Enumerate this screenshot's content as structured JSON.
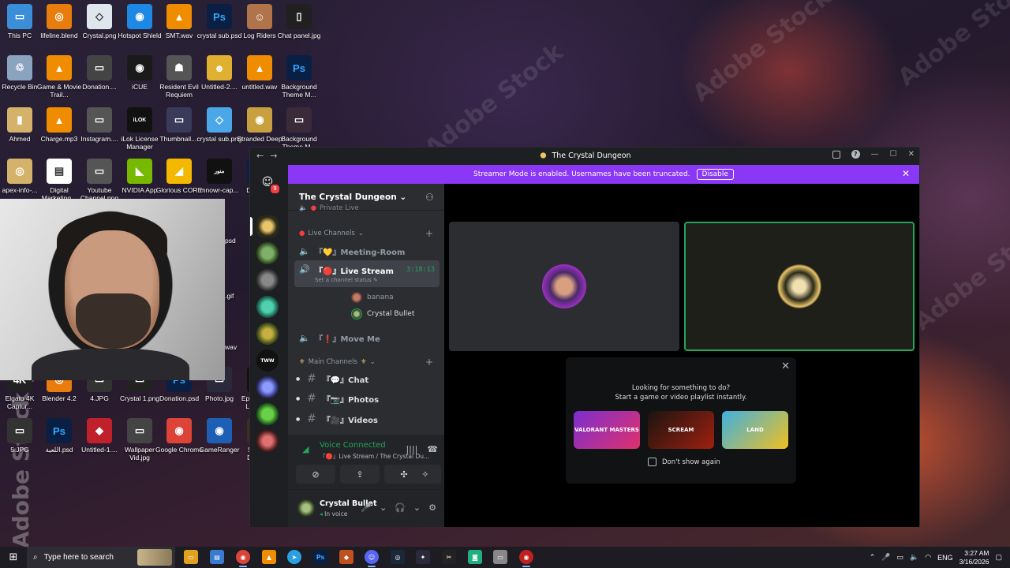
{
  "desktop": {
    "icons": [
      {
        "label": "This PC",
        "color": "#3b8fd9",
        "glyph": "▭"
      },
      {
        "label": "lifeline.blend",
        "color": "#e87d0d",
        "glyph": "◎"
      },
      {
        "label": "Crystal.png",
        "color": "#dfe6ee",
        "glyph": "◇"
      },
      {
        "label": "Hotspot Shield",
        "color": "#1e88e5",
        "glyph": "◉"
      },
      {
        "label": "SMT.wav",
        "color": "#f08c00",
        "glyph": "▲"
      },
      {
        "label": "crystal sub.psd",
        "color": "#0a1f44",
        "glyph": "Ps"
      },
      {
        "label": "Log Riders",
        "color": "#b0734a",
        "glyph": "☺"
      },
      {
        "label": "Chat panel.jpg",
        "color": "#202020",
        "glyph": "▯"
      },
      {
        "label": "Recycle Bin",
        "color": "#8aa4c0",
        "glyph": "♲"
      },
      {
        "label": "Game & Movie Trail...",
        "color": "#f08c00",
        "glyph": "▲"
      },
      {
        "label": "Donation....",
        "color": "#444",
        "glyph": "▭"
      },
      {
        "label": "iCUE",
        "color": "#1a1a1a",
        "glyph": "◉"
      },
      {
        "label": "Resident Evil Requiem",
        "color": "#555",
        "glyph": "☗"
      },
      {
        "label": "Untitled-2....",
        "color": "#e0b030",
        "glyph": "☻"
      },
      {
        "label": "untitled.wav",
        "color": "#f08c00",
        "glyph": "▲"
      },
      {
        "label": "Background Theme M...",
        "color": "#0a1f44",
        "glyph": "Ps"
      },
      {
        "label": "Ahmed",
        "color": "#d4b26a",
        "glyph": "▮"
      },
      {
        "label": "Charge.mp3",
        "color": "#f08c00",
        "glyph": "▲"
      },
      {
        "label": "Instagram....",
        "color": "#555",
        "glyph": "▭"
      },
      {
        "label": "iLok License Manager",
        "color": "#111",
        "glyph": "iLOK"
      },
      {
        "label": "Thumbnail....",
        "color": "#3a3a5a",
        "glyph": "▭"
      },
      {
        "label": "crystal sub.png",
        "color": "#4aa8e8",
        "glyph": "◇"
      },
      {
        "label": "Stranded Deep",
        "color": "#c8a040",
        "glyph": "◉"
      },
      {
        "label": "Background Theme M...",
        "color": "#3a2a3a",
        "glyph": "▭"
      },
      {
        "label": "apex-info-...",
        "color": "#d4b26a",
        "glyph": "◎"
      },
      {
        "label": "Digital Marketing...",
        "color": "#fff",
        "glyph": "▤"
      },
      {
        "label": "Youtube Channel.png",
        "color": "#555",
        "glyph": "▭"
      },
      {
        "label": "NVIDIA App",
        "color": "#76b900",
        "glyph": "◣"
      },
      {
        "label": "Glorious CORE",
        "color": "#f5b800",
        "glyph": "◢"
      },
      {
        "label": "mnowr-cap...",
        "color": "#111",
        "glyph": "منور"
      },
      {
        "label": "Ditto.psd",
        "color": "#0a1f44",
        "glyph": "Ps"
      },
      {
        "label": "photo 3 loading.jpg",
        "color": "#7a3aa0",
        "glyph": "▭"
      },
      {
        "label": "Elgato 4K Captur...",
        "color": "#222",
        "glyph": "4K"
      },
      {
        "label": "Blender 4.2",
        "color": "#e87d0d",
        "glyph": "◎"
      },
      {
        "label": "4.JPG",
        "color": "#333",
        "glyph": "▭"
      },
      {
        "label": "Crystal 1.png",
        "color": "#222",
        "glyph": "▭"
      },
      {
        "label": "Donation.psd",
        "color": "#0a1f44",
        "glyph": "Ps"
      },
      {
        "label": "Photo.jpg",
        "color": "#2a2a3a",
        "glyph": "▭"
      },
      {
        "label": "Epic Games Launcher",
        "color": "#111",
        "glyph": "EPIC"
      },
      {
        "label": "CrystalDisk...",
        "color": "#5cb85c",
        "glyph": "◉"
      },
      {
        "label": "5.JPG",
        "color": "#333",
        "glyph": "▭"
      },
      {
        "label": "اللعبة.psd",
        "color": "#0a1f44",
        "glyph": "Ps"
      },
      {
        "label": "Untitled-1....",
        "color": "#c0202a",
        "glyph": "◆"
      },
      {
        "label": "Wallpaper Vid.jpg",
        "color": "#444",
        "glyph": "▭"
      },
      {
        "label": "Google Chrome",
        "color": "#db4437",
        "glyph": "◉"
      },
      {
        "label": "GameRanger",
        "color": "#1d5fb4",
        "glyph": "◉"
      },
      {
        "label": "Survival Door.jpg",
        "color": "#3a3020",
        "glyph": "▭"
      },
      {
        "label": "Granny Escape...",
        "color": "#3a2a20",
        "glyph": "☹"
      }
    ],
    "peek_labels": [
      "psd",
      ".gif",
      "wav"
    ]
  },
  "watermarks": {
    "diag": "Adobe Stock",
    "vertical": "Adobe Stock | #6"
  },
  "discord": {
    "window_title": "The Crystal Dungeon",
    "banner": {
      "text": "Streamer Mode is enabled. Usernames have been truncated.",
      "button": "Disable"
    },
    "server_name": "The Crystal Dungeon",
    "rail_badge": "9",
    "categories": {
      "live": "Live Channels",
      "main": "Main Channels"
    },
    "partial_channel": "Private Live",
    "channels": {
      "meeting": "『💛』Meeting-Room",
      "live": "『🔴』Live Stream",
      "live_timer": "3:18:13",
      "live_status": "Set a channel status",
      "move": "『❗』Move Me"
    },
    "members": [
      "banana",
      "Crystal Bullet"
    ],
    "text_channels": [
      "『💬』Chat",
      "『📷』Photos",
      "『🎥』Videos"
    ],
    "voice": {
      "status": "Voice Connected",
      "location": "『🔴』Live Stream / The Crystal Du..."
    },
    "user": {
      "name": "Crystal Bullet",
      "status": "In voice"
    },
    "activity": {
      "line1": "Looking for something to do?",
      "line2": "Start a game or video playlist instantly.",
      "games": [
        {
          "name": "VALORANT MASTERS",
          "color1": "#7b2fd0",
          "color2": "#e0306a"
        },
        {
          "name": "SCREAM",
          "color1": "#1a1410",
          "color2": "#a02010"
        },
        {
          "name": "LAND",
          "color1": "#3fb0e0",
          "color2": "#f0c020"
        }
      ],
      "checkbox": "Don't show again"
    },
    "accent": "#8a38f5",
    "speaking_color": "#23a55a"
  },
  "taskbar": {
    "search_placeholder": "Type here to search",
    "lang": "ENG",
    "time": "3:27 AM",
    "date": "3/16/2026"
  }
}
